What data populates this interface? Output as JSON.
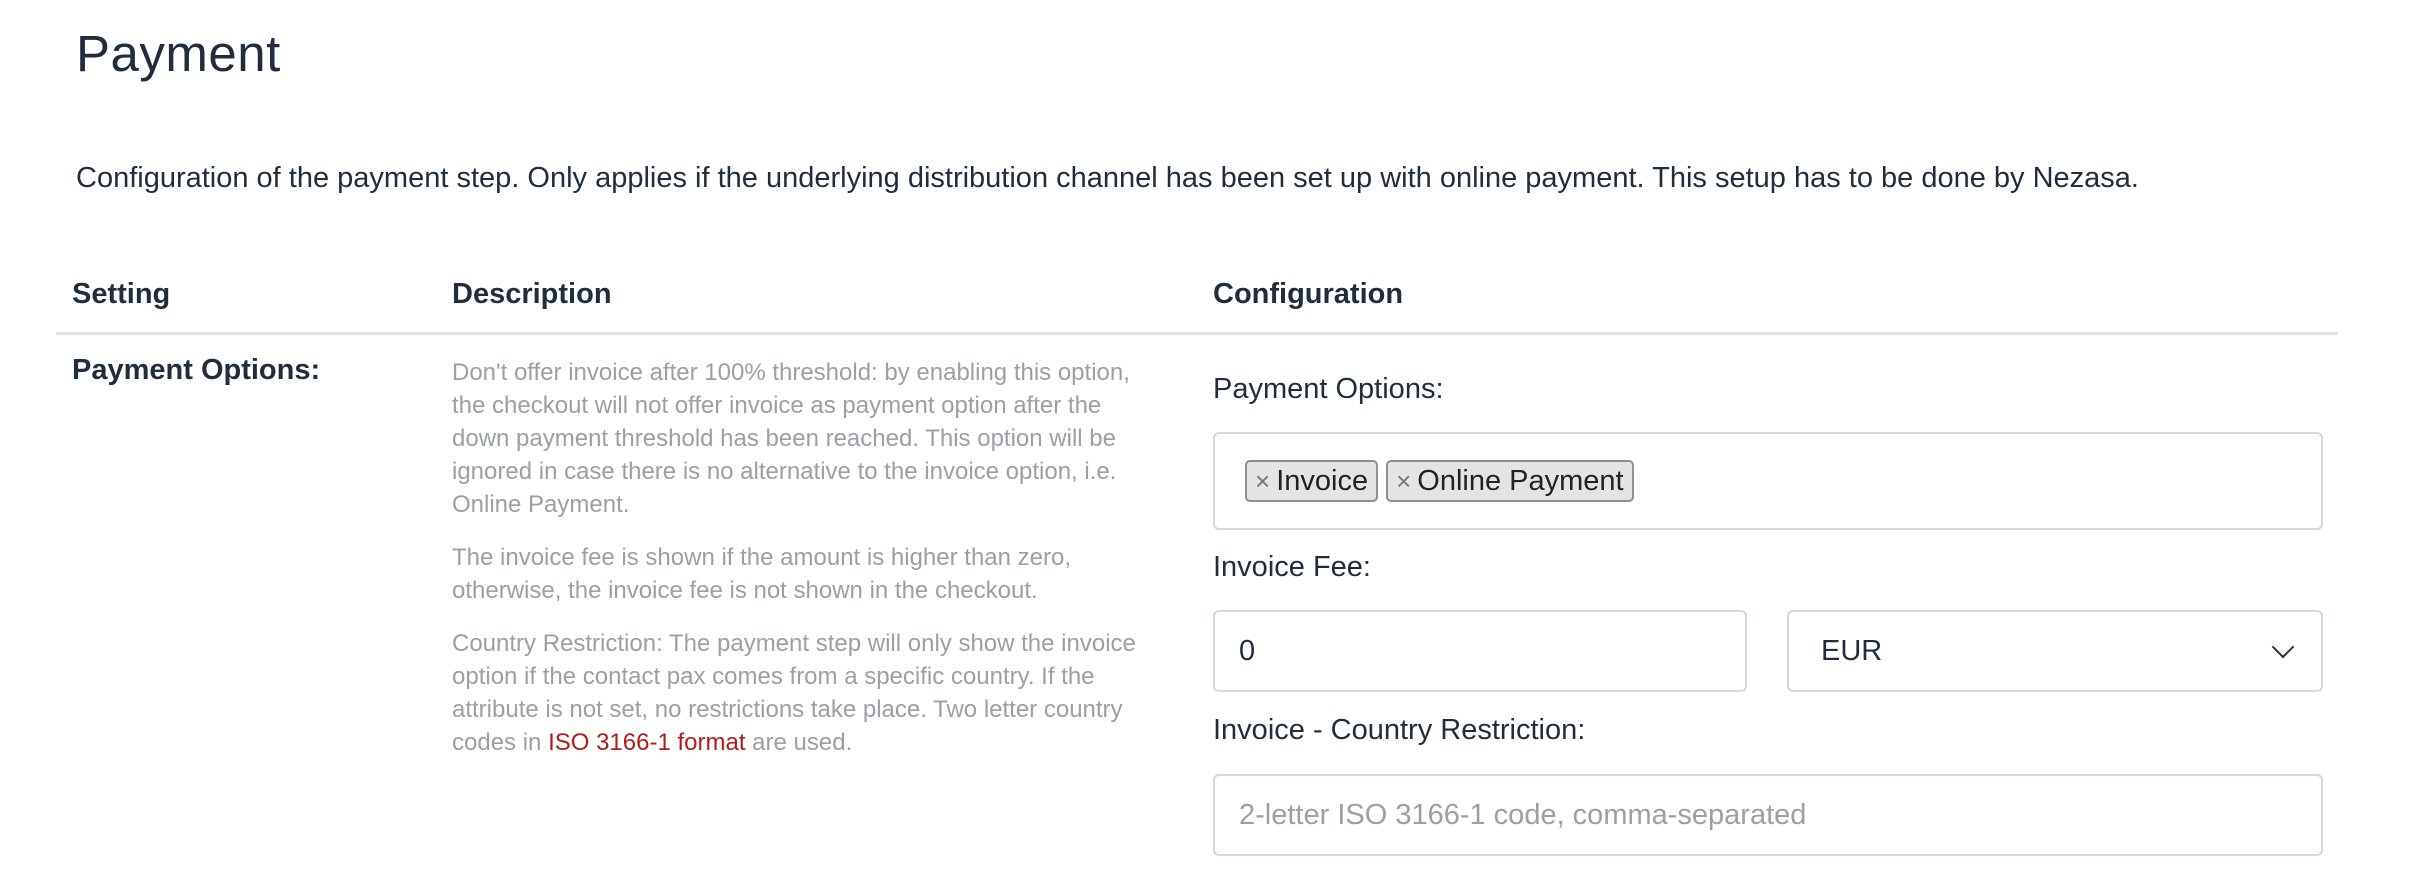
{
  "page": {
    "title": "Payment",
    "intro": "Configuration of the payment step. Only applies if the underlying distribution channel has been set up with online payment. This setup has to be done by Nezasa."
  },
  "table": {
    "headers": {
      "setting": "Setting",
      "description": "Description",
      "configuration": "Configuration"
    }
  },
  "row": {
    "setting": "Payment Options:",
    "description": {
      "p1": "Don't offer invoice after 100% threshold: by enabling this option, the checkout will not offer invoice as payment option after the down payment threshold has been reached. This option will be ignored in case there is no alternative to the invoice option, i.e. Online Payment.",
      "p2": "The invoice fee is shown if the amount is higher than zero, otherwise, the invoice fee is not shown in the checkout.",
      "p3_before": "Country Restriction: The payment step will only show the invoice option if the contact pax comes from a specific country. If the attribute is not set, no restrictions take place. Two letter country codes in ",
      "p3_link": "ISO 3166-1 format",
      "p3_after": " are used."
    },
    "config": {
      "payment_options_label": "Payment Options:",
      "payment_options": [
        {
          "remove": "×",
          "label": "Invoice"
        },
        {
          "remove": "×",
          "label": "Online Payment"
        }
      ],
      "invoice_fee_label": "Invoice Fee:",
      "invoice_fee_value": "0",
      "currency_selected": "EUR",
      "country_label": "Invoice - Country Restriction:",
      "country_placeholder": "2-letter ISO 3166-1 code, comma-separated",
      "country_value": ""
    }
  },
  "colors": {
    "text": "#1f2d3d",
    "muted": "#9aa0a6",
    "link": "#b31b1b",
    "border": "#d3d8de"
  },
  "icons": {
    "currency_dropdown": "chevron-down-icon",
    "tag_remove": "close-icon"
  }
}
